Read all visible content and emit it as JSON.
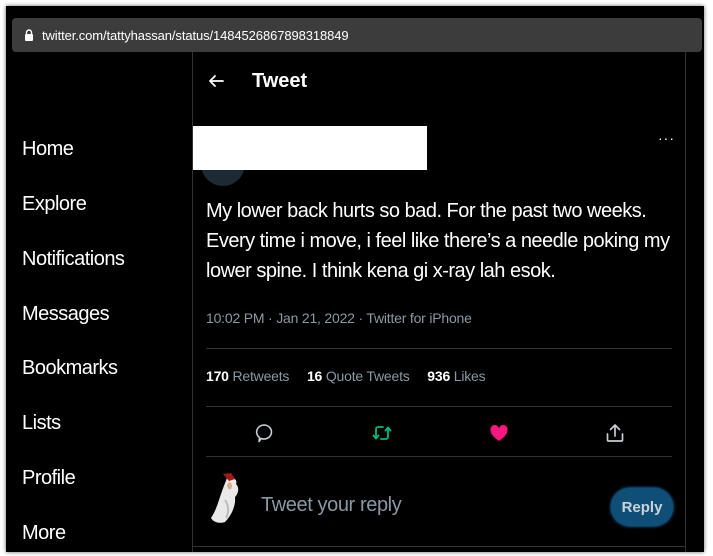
{
  "browser": {
    "url": "twitter.com/tattyhassan/status/1484526867898318849",
    "lock_icon": "lock-icon"
  },
  "sidebar": {
    "items": [
      {
        "label": "Home"
      },
      {
        "label": "Explore"
      },
      {
        "label": "Notifications"
      },
      {
        "label": "Messages"
      },
      {
        "label": "Bookmarks"
      },
      {
        "label": "Lists"
      },
      {
        "label": "Profile"
      },
      {
        "label": "More"
      }
    ]
  },
  "header": {
    "title": "Tweet",
    "back_icon": "arrow-left-icon"
  },
  "tweet": {
    "more_label": "···",
    "text": "My lower back hurts so bad. For the past two weeks. Every time i move, i feel like there’s a needle poking my lower spine. I think kena gi x-ray lah esok.",
    "time": "10:02 PM",
    "date": "Jan 21, 2022",
    "source": "Twitter for iPhone",
    "separator": "·",
    "stats": {
      "retweets_count": "170",
      "retweets_label": "Retweets",
      "quotes_count": "16",
      "quotes_label": "Quote Tweets",
      "likes_count": "936",
      "likes_label": "Likes"
    },
    "actions": [
      {
        "icon": "comment-icon",
        "color": "#c7cdd2"
      },
      {
        "icon": "retweet-icon",
        "color": "#00ba7c"
      },
      {
        "icon": "heart-icon",
        "color": "#f91880"
      },
      {
        "icon": "share-icon",
        "color": "#c7cdd2"
      }
    ]
  },
  "reply": {
    "placeholder": "Tweet your reply",
    "button_label": "Reply"
  },
  "colors": {
    "background": "#000000",
    "text": "#ffffff",
    "muted": "#8b98a5",
    "accent": "#1d9bf0",
    "retweet": "#00ba7c",
    "like": "#f91880"
  }
}
